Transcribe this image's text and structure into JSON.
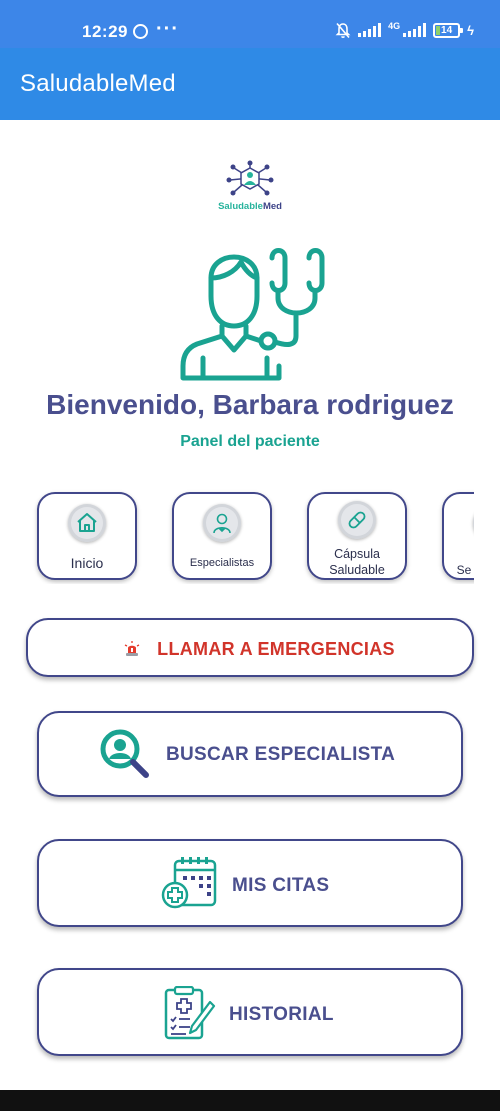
{
  "status_bar": {
    "time": "12:29",
    "dots": "···",
    "network": "4G",
    "battery": "14"
  },
  "app_bar": {
    "title": "SaludableMed"
  },
  "logo": {
    "text_part1": "Saludable",
    "text_part2": "Med"
  },
  "welcome": {
    "title": "Bienvenido, Barbara rodriguez",
    "subtitle": "Panel del paciente"
  },
  "menu": [
    {
      "label": "Inicio",
      "icon": "home-icon"
    },
    {
      "label": "Especialistas",
      "icon": "doctor-icon"
    },
    {
      "label_line1": "Cápsula",
      "label_line2": "Saludable",
      "icon": "pill-icon"
    },
    {
      "label": "Se",
      "icon": "settings-icon"
    }
  ],
  "buttons": {
    "emergency": "LLAMAR A EMERGENCIAS",
    "search": "BUSCAR ESPECIALISTA",
    "appointments": "MIS CITAS",
    "history": "HISTORIAL"
  },
  "colors": {
    "status_bar": "#3d86e8",
    "app_bar": "#2f8ae6",
    "primary_text": "#4a4f8e",
    "accent_teal": "#1aa391",
    "emergency_red": "#d1342a",
    "border": "#41478a"
  }
}
